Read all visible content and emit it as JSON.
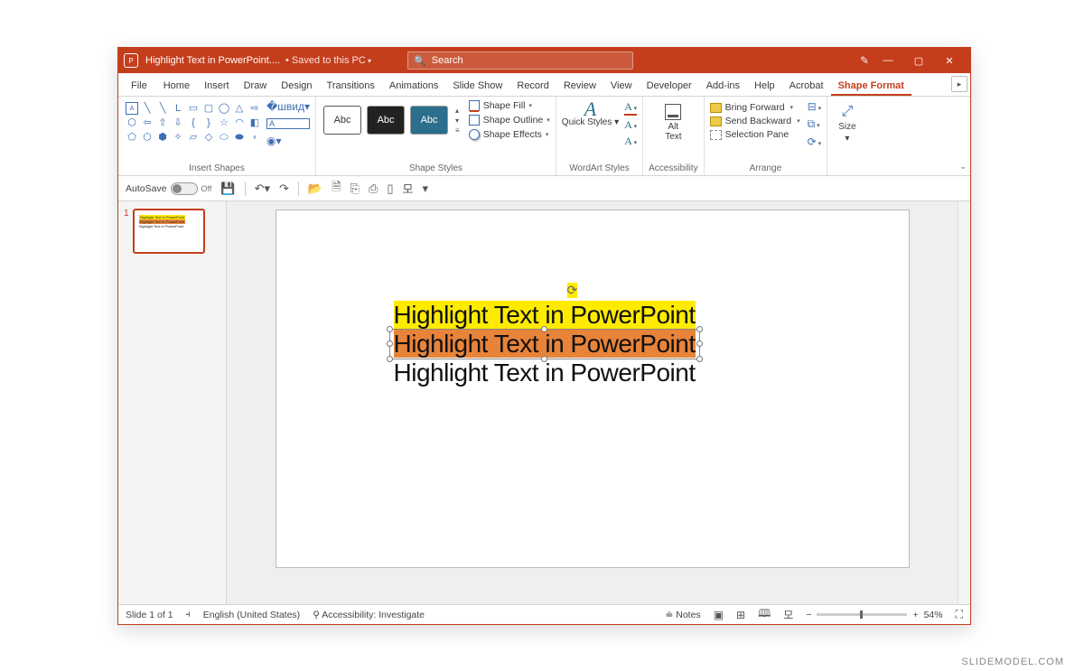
{
  "title": {
    "filename": "Highlight Text in PowerPoint....",
    "saved": "• Saved to this PC"
  },
  "search": {
    "placeholder": "Search"
  },
  "tabs": [
    "File",
    "Home",
    "Insert",
    "Draw",
    "Design",
    "Transitions",
    "Animations",
    "Slide Show",
    "Record",
    "Review",
    "View",
    "Developer",
    "Add-ins",
    "Help",
    "Acrobat",
    "Shape Format"
  ],
  "active_tab": "Shape Format",
  "ribbon": {
    "insert_shapes": "Insert Shapes",
    "shape_styles": "Shape Styles",
    "style_label": "Abc",
    "shape_fill": "Shape Fill",
    "shape_outline": "Shape Outline",
    "shape_effects": "Shape Effects",
    "wordart": "WordArt Styles",
    "quick_styles": "Quick Styles",
    "accessibility": "Accessibility",
    "alt_text": "Alt Text",
    "arrange": "Arrange",
    "bring_forward": "Bring Forward",
    "send_backward": "Send Backward",
    "selection_pane": "Selection Pane",
    "size": "Size"
  },
  "qat": {
    "autosave": "AutoSave",
    "autosave_state": "Off"
  },
  "thumb": {
    "num": "1"
  },
  "slide": {
    "line1": "Highlight Text in PowerPoint",
    "line2": "Highlight Text in PowerPoint",
    "line3": "Highlight Text in PowerPoint",
    "highlight1": "#ffeb00",
    "highlight2": "#e8833a"
  },
  "status": {
    "slide": "Slide 1 of 1",
    "lang": "English (United States)",
    "access": "Accessibility: Investigate",
    "notes": "Notes",
    "zoom": "54%"
  },
  "watermark": "SLIDEMODEL.COM"
}
